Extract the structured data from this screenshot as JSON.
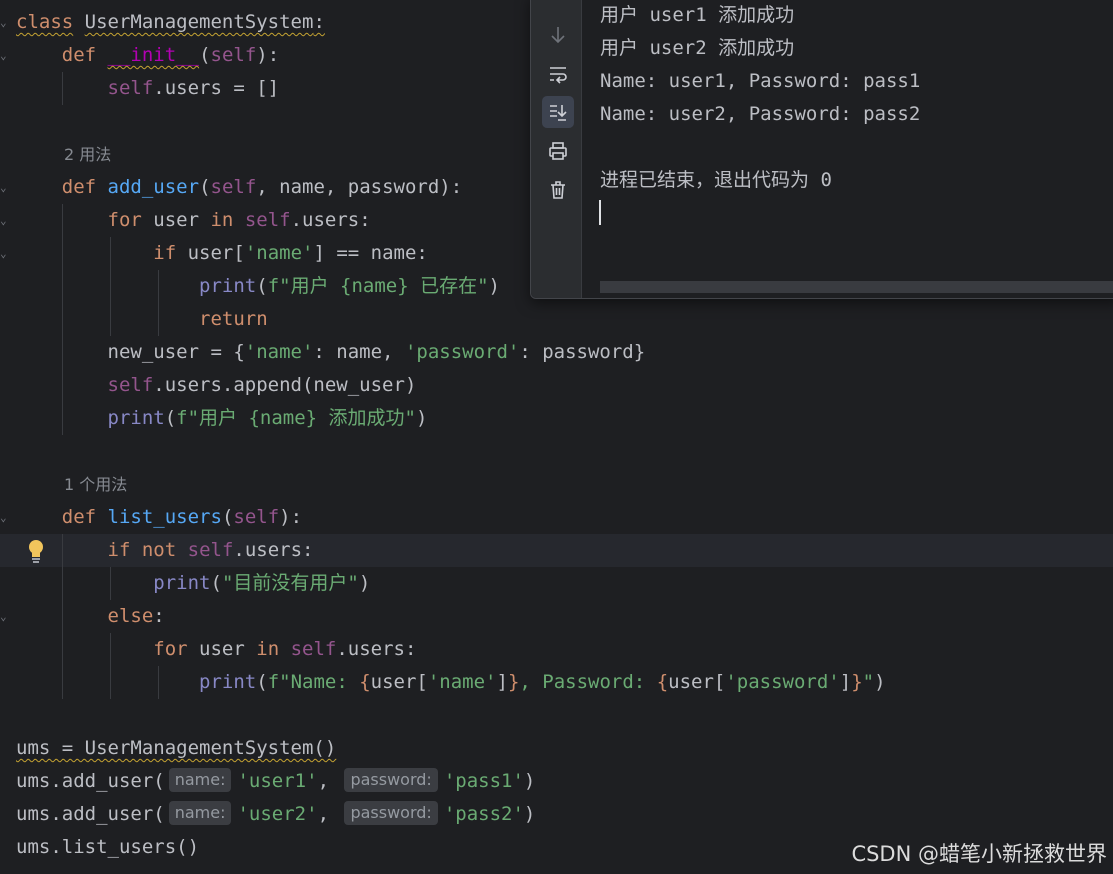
{
  "editor": {
    "usages_2": "2 用法",
    "usages_1": "1 个用法",
    "class_kw": "class",
    "class_name": "UserManagementSystem",
    "def_kw": "def",
    "init_name": "__init__",
    "self_kw": "self",
    "users_attr": ".users = []",
    "add_user_name": "add_user",
    "add_user_params": ", name, password):",
    "for_kw": "for",
    "in_kw": "in",
    "if_kw": "if",
    "not_kw": "not",
    "else_kw": "else",
    "return_kw": "return",
    "print_fn": "print",
    "list_users_name": "list_users",
    "str_name": "'name'",
    "str_password": "'password'",
    "msg_exists": "f\"用户 {name} 已存在\"",
    "msg_added": "f\"用户 {name} 添加成功\"",
    "msg_no_users": "\"目前没有用户\"",
    "msg_list_a": "f\"Name: ",
    "msg_list_b": ", Password: ",
    "ums_line": "ums = UserManagementSystem()",
    "ums_add": "ums.add_user(",
    "ums_list": "ums.list_users()",
    "hint_name": "name:",
    "hint_password": "password:",
    "arg_user1": "'user1'",
    "arg_pass1": "'pass1'",
    "arg_user2": "'user2'",
    "arg_pass2": "'pass2'"
  },
  "run_output": {
    "lines": [
      "用户 user1 添加成功",
      "用户 user2 添加成功",
      "Name: user1, Password: pass1",
      "Name: user2, Password: pass2",
      "",
      "进程已结束，退出代码为 0"
    ],
    "toolbar": [
      "down-arrow-icon",
      "soft-wrap-icon",
      "scroll-to-end-icon",
      "print-icon",
      "trash-icon"
    ]
  },
  "watermark": "CSDN @蜡笔小新拯救世界",
  "colors": {
    "keyword": "#cf8e6d",
    "string": "#6aab73",
    "self": "#94558d",
    "function": "#56a8f5",
    "builtin": "#8888c6",
    "background": "#1e1f22"
  }
}
